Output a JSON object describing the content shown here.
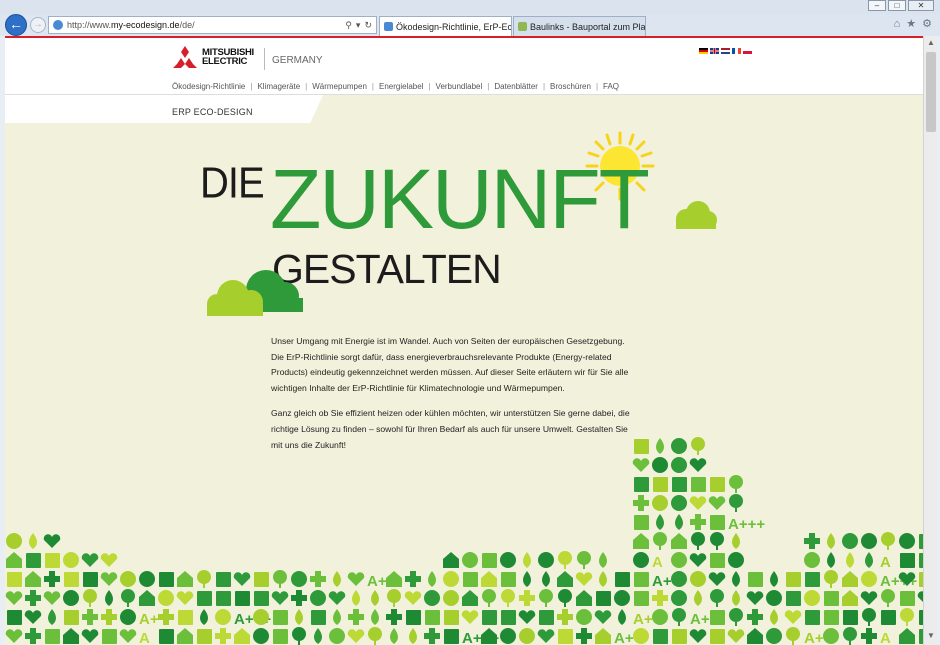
{
  "browser": {
    "window_controls": [
      "–",
      "□",
      "✕"
    ],
    "back_icon": "←",
    "forward_icon": "→",
    "address": {
      "prefix": "http://www.",
      "host": "my-ecodesign.de",
      "path": "/de/",
      "search_icon": "⚲",
      "dropdown_icon": "▾",
      "refresh_icon": "↻"
    },
    "tabs": [
      {
        "label": "Ökodesign-Richtlinie, ErP-Ec...",
        "close": "✕",
        "active": true
      },
      {
        "label": "Baulinks - Bauportal zum Plane...",
        "active": false
      }
    ],
    "right_tools": [
      "⌂",
      "★",
      "⚙"
    ]
  },
  "site": {
    "accent_red": "#d5202a",
    "accent_green": "#2e9a3a",
    "logo": {
      "line1": "MITSUBISHI",
      "line2": "ELECTRIC"
    },
    "country": "GERMANY",
    "flags": [
      "de",
      "gb",
      "nl",
      "fr",
      "pl"
    ],
    "nav": [
      "Ökodesign-Richtlinie",
      "Klimageräte",
      "Wärmepumpen",
      "Energielabel",
      "Verbundlabel",
      "Datenblätter",
      "Broschüren",
      "FAQ"
    ],
    "breadcrumb": "ERP ECO-DESIGN"
  },
  "hero": {
    "word1": "DIE",
    "word2": "ZUKUNFT",
    "word3": "GESTALTEN"
  },
  "intro": {
    "p1": "Unser Umgang mit Energie ist im Wandel. Auch von Seiten der europäischen Gesetzgebung. Die ErP-Richtlinie sorgt dafür, dass energieverbrauchsrelevante Produkte (Energy-related Products) eindeutig gekennzeichnet werden müssen. Auf dieser Seite erläutern wir für Sie alle wichtigen Inhalte der ErP-Richtlinie für Klimatechnologie und Wärmepumpen.",
    "p2": "Ganz gleich ob Sie effizient heizen oder kühlen möchten, wir unterstützen Sie gerne dabei, die richtige Lösung zu finden – sowohl für Ihren Bedarf als auch für unsere Umwelt. Gestalten Sie mit uns die Zukunft!"
  },
  "skyline": {
    "colors": [
      "#2e9a3a",
      "#1f8a34",
      "#6cbf3b",
      "#a6cf2e",
      "#bcd936"
    ],
    "labels": [
      "A++",
      "A+++",
      "A+",
      "A"
    ]
  },
  "scrollbar": {
    "up": "▲",
    "down": "▼"
  }
}
